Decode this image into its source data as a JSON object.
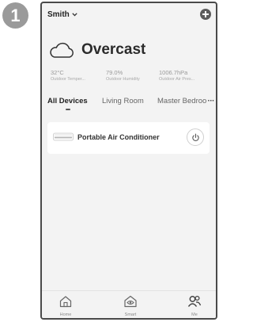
{
  "step": "1",
  "header": {
    "home_name": "Smith"
  },
  "weather": {
    "condition": "Overcast",
    "stats": [
      {
        "value": "32°C",
        "label": "Outdoor Temper..."
      },
      {
        "value": "79.0%",
        "label": "Outdoor Humidity"
      },
      {
        "value": "1006.7hPa",
        "label": "Outdoor Air Pres..."
      }
    ]
  },
  "tabs": {
    "items": [
      "All Devices",
      "Living Room",
      "Master Bedroo"
    ],
    "active": "All Devices",
    "more": "···"
  },
  "devices": [
    {
      "name": "Portable Air Conditioner"
    }
  ],
  "nav": {
    "items": [
      "Home",
      "Smart",
      "Me"
    ]
  },
  "icons": {
    "home": "home-icon",
    "smart": "smart-scene-icon",
    "me": "profile-icon",
    "add": "plus-icon",
    "power": "power-icon",
    "cloud": "cloud-icon",
    "device": "air-conditioner-icon"
  }
}
